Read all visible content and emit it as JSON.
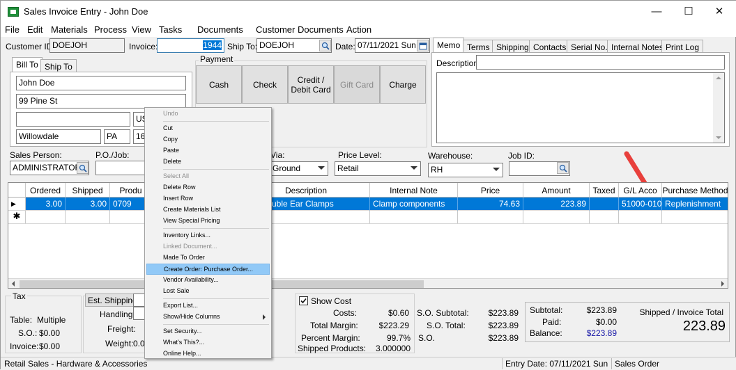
{
  "window": {
    "title": "Sales Invoice Entry - John Doe",
    "minimize": "—",
    "maximize": "☐",
    "close": "✕"
  },
  "menu": [
    "File",
    "Edit",
    "Materials",
    "Process",
    "View",
    "Tasks",
    "Documents",
    "Customer Documents",
    "Action"
  ],
  "header": {
    "customer_id_label": "Customer ID:",
    "customer_id": "DOEJOH",
    "invoice_label": "Invoice:",
    "invoice": "1944",
    "ship_to_label": "Ship To:",
    "ship_to": "DOEJOH",
    "date_label": "Date:",
    "date": "07/11/2021 Sun"
  },
  "address": {
    "tabs": [
      "Bill To",
      "Ship To"
    ],
    "name": "John Doe",
    "street": "99 Pine St",
    "line3": "",
    "country": "US",
    "city": "Willowdale",
    "state": "PA",
    "zip": "16"
  },
  "payment": {
    "label": "Payment",
    "buttons": [
      {
        "label": "Cash",
        "enabled": true
      },
      {
        "label": "Check",
        "enabled": true
      },
      {
        "label": "Credit / Debit Card",
        "enabled": true
      },
      {
        "label": "Gift Card",
        "enabled": false
      },
      {
        "label": "Charge",
        "enabled": true
      }
    ]
  },
  "memo": {
    "tabs": [
      "Memo",
      "Terms",
      "Shipping",
      "Contacts",
      "Serial No.",
      "Internal Notes",
      "Print Log"
    ],
    "description_label": "Description:",
    "description": ""
  },
  "fields": {
    "sales_person_label": "Sales Person:",
    "sales_person": "ADMINISTRATOR",
    "po_label": "P.O./Job:",
    "po": "",
    "via_label": "Via:",
    "via": "Ground",
    "price_level_label": "Price Level:",
    "price_level": "Retail",
    "warehouse_label": "Warehouse:",
    "warehouse": "RH",
    "job_id_label": "Job ID:",
    "job_id": ""
  },
  "grid": {
    "columns": [
      "Ordered",
      "Shipped",
      "Produ",
      "Description",
      "Internal Note",
      "Price",
      "Amount",
      "Taxed",
      "G/L Acco",
      "Purchase Method"
    ],
    "rows": [
      {
        "ordered": "3.00",
        "shipped": "3.00",
        "product": "0709",
        "description": "uble Ear Clamps",
        "internal_note": "Clamp components",
        "price": "74.63",
        "amount": "223.89",
        "taxed": "",
        "gl": "51000-010",
        "purchase_method": "Replenishment"
      }
    ],
    "new_row_marker": "✱",
    "current_row_marker": "▶"
  },
  "context_menu": {
    "items": [
      {
        "label": "Undo",
        "disabled": true
      },
      {
        "sep": true
      },
      {
        "label": "Cut"
      },
      {
        "label": "Copy"
      },
      {
        "label": "Paste"
      },
      {
        "label": "Delete"
      },
      {
        "sep": true
      },
      {
        "label": "Select All",
        "disabled": true
      },
      {
        "label": "Delete Row"
      },
      {
        "label": "Insert Row"
      },
      {
        "label": "Create Materials List"
      },
      {
        "label": "View Special Pricing"
      },
      {
        "sep": true
      },
      {
        "label": "Inventory Links..."
      },
      {
        "label": "Linked Document...",
        "disabled": true
      },
      {
        "label": "Made To Order"
      },
      {
        "label": "Create Order: Purchase Order...",
        "highlighted": true
      },
      {
        "label": "Vendor Availability..."
      },
      {
        "label": "Lost Sale"
      },
      {
        "sep": true
      },
      {
        "label": "Export List..."
      },
      {
        "label": "Show/Hide Columns",
        "submenu": true
      },
      {
        "sep": true
      },
      {
        "label": "Set Security..."
      },
      {
        "label": "What's This?..."
      },
      {
        "label": "Online Help..."
      }
    ]
  },
  "tax": {
    "label": "Tax",
    "table_label": "Table:",
    "table": "Multiple",
    "so_label": "S.O.:",
    "so": "$0.00",
    "invoice_label": "Invoice:",
    "invoice": "$0.00"
  },
  "shipping": {
    "est_button": "Est. Shipping:",
    "handling_label": "Handling:",
    "freight_label": "Freight:",
    "weight_label": "Weight:",
    "weight": "0.03"
  },
  "cost": {
    "show_cost_label": "Show Cost",
    "costs_label": "Costs:",
    "costs": "$0.60",
    "total_margin_label": "Total Margin:",
    "total_margin": "$223.29",
    "percent_margin_label": "Percent Margin:",
    "percent_margin": "99.7%",
    "shipped_products_label": "Shipped Products:",
    "shipped_products": "3.000000"
  },
  "so_totals": {
    "subtotal_label": "S.O. Subtotal:",
    "subtotal": "$223.89",
    "total_label": "S.O. Total:",
    "total": "$223.89",
    "so_label": "S.O.",
    "so": "$223.89"
  },
  "totals": {
    "subtotal_label": "Subtotal:",
    "subtotal": "$223.89",
    "paid_label": "Paid:",
    "paid": "$0.00",
    "balance_label": "Balance:",
    "balance": "$223.89",
    "shipped_invoice_label": "Shipped / Invoice Total",
    "shipped_invoice_total": "223.89"
  },
  "status": {
    "left": "Retail Sales - Hardware & Accessories",
    "entry_date": "Entry Date: 07/11/2021 Sun",
    "mode": "Sales Order"
  },
  "colors": {
    "selection": "#0078d7",
    "menu_highlight": "#91c9f7",
    "arrow": "#e8403c",
    "balance_text": "#1a1aa8"
  }
}
